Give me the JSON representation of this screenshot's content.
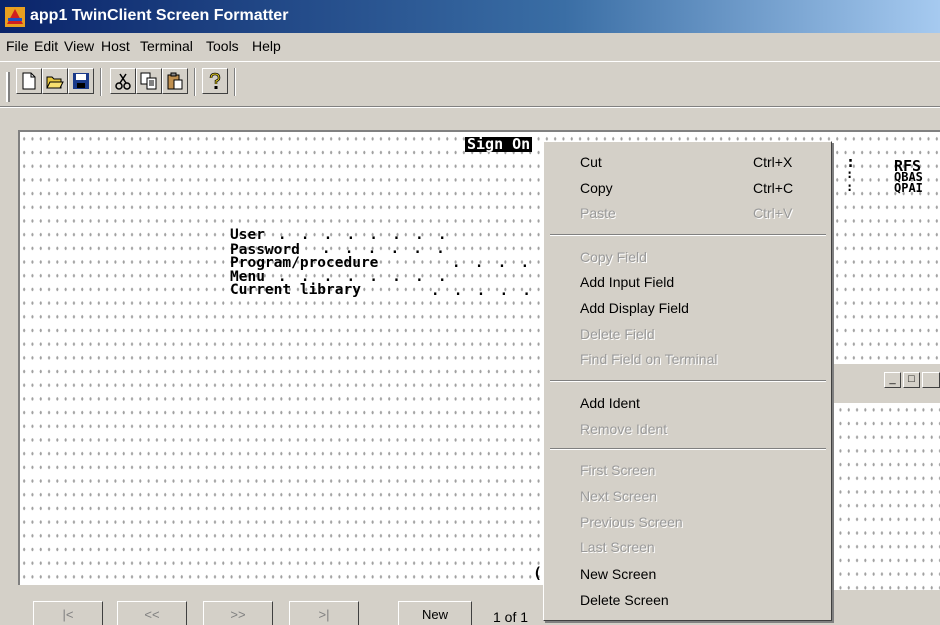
{
  "window": {
    "title": "app1 TwinClient Screen Formatter"
  },
  "menubar": [
    "File",
    "Edit",
    "View",
    "Host",
    "Terminal",
    "Tools",
    "Help"
  ],
  "toolbar": [
    "new-icon",
    "open-icon",
    "save-icon",
    "cut-icon",
    "copy-icon",
    "paste-icon",
    "help-icon"
  ],
  "screen": {
    "title": "Sign On",
    "right_labels": [
      "RFS",
      "QBAS",
      "QPAI"
    ],
    "fields": [
      "User",
      "Password",
      "Program/procedure",
      "Menu",
      "Current library"
    ],
    "fragment": "("
  },
  "nav": {
    "first": "|<",
    "prev": "<<",
    "next": ">>",
    "last": ">|",
    "new": "New",
    "page": "1 of 1"
  },
  "context_menu": [
    {
      "label": "Cut",
      "shortcut": "Ctrl+X",
      "enabled": true
    },
    {
      "label": "Copy",
      "shortcut": "Ctrl+C",
      "enabled": true
    },
    {
      "label": "Paste",
      "shortcut": "Ctrl+V",
      "enabled": false
    },
    {
      "label": "Copy Field",
      "enabled": false
    },
    {
      "label": "Add Input Field",
      "enabled": true
    },
    {
      "label": "Add Display Field",
      "enabled": true
    },
    {
      "label": "Delete Field",
      "enabled": false
    },
    {
      "label": "Find Field on Terminal",
      "enabled": false
    },
    {
      "label": "Add Ident",
      "enabled": true
    },
    {
      "label": "Remove Ident",
      "enabled": false
    },
    {
      "label": "First Screen",
      "enabled": false
    },
    {
      "label": "Next Screen",
      "enabled": false
    },
    {
      "label": "Previous Screen",
      "enabled": false
    },
    {
      "label": "Last Screen",
      "enabled": false
    },
    {
      "label": "New Screen",
      "enabled": true
    },
    {
      "label": "Delete Screen",
      "enabled": true
    }
  ]
}
